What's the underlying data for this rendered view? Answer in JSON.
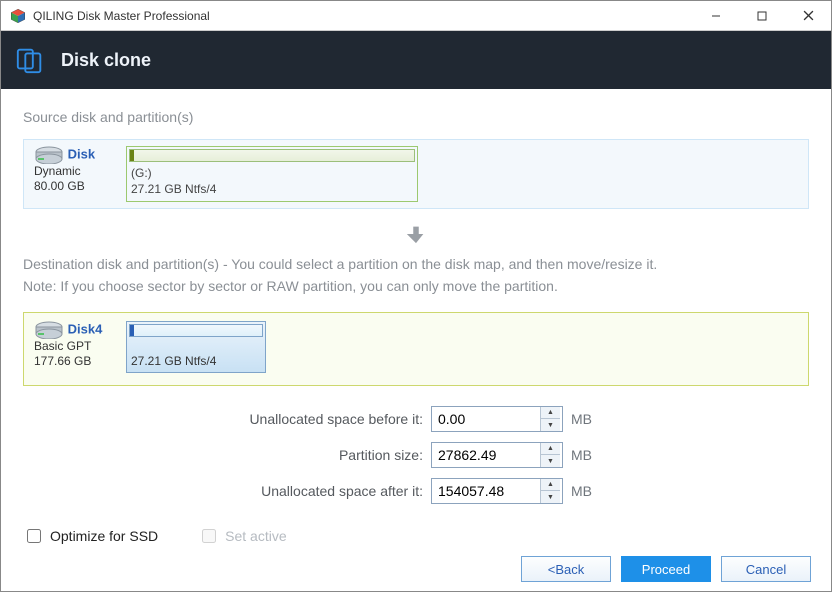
{
  "window": {
    "title": "QILING Disk Master Professional"
  },
  "header": {
    "page_title": "Disk clone"
  },
  "source": {
    "section_label": "Source disk and partition(s)",
    "disk_name": "Disk",
    "disk_type": "Dynamic",
    "disk_size": "80.00 GB",
    "part_letter": "(G:)",
    "part_desc": "27.21 GB Ntfs/4"
  },
  "destination": {
    "note_line1": "Destination disk and partition(s) - You could select a partition on the disk map, and then move/resize it.",
    "note_line2": "Note: If you choose sector by sector or RAW partition, you can only move the partition.",
    "disk_name": "Disk4",
    "disk_type": "Basic GPT",
    "disk_size": "177.66 GB",
    "part_desc": "27.21 GB Ntfs/4"
  },
  "fields": {
    "before_label": "Unallocated space before it:",
    "before_value": "0.00",
    "size_label": "Partition size:",
    "size_value": "27862.49",
    "after_label": "Unallocated space after it:",
    "after_value": "154057.48",
    "unit": "MB"
  },
  "options": {
    "ssd_label": "Optimize for SSD",
    "active_label": "Set active"
  },
  "buttons": {
    "back": "<Back",
    "proceed": "Proceed",
    "cancel": "Cancel"
  }
}
